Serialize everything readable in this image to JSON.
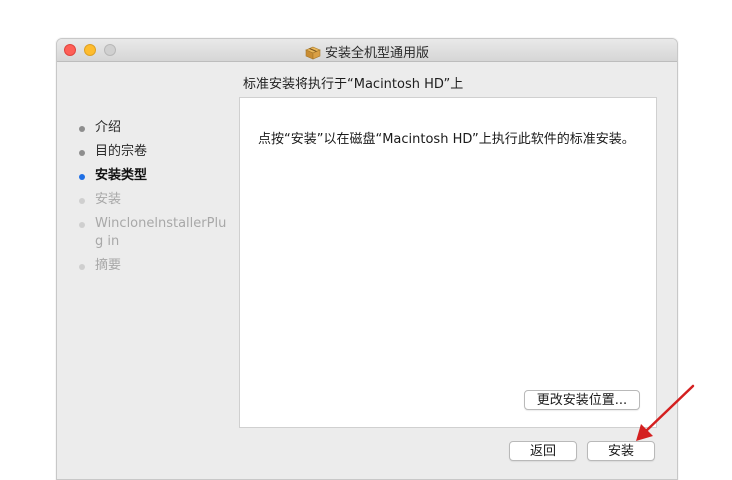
{
  "window": {
    "title": "安装全机型通用版",
    "heading": "标准安装将执行于“Macintosh HD”上"
  },
  "sidebar": {
    "steps": [
      {
        "label": "介绍",
        "state": "done"
      },
      {
        "label": "目的宗卷",
        "state": "done"
      },
      {
        "label": "安装类型",
        "state": "current"
      },
      {
        "label": "安装",
        "state": "todo"
      },
      {
        "label": "WinclonelnstallerPlug in",
        "state": "todo"
      },
      {
        "label": "摘要",
        "state": "todo"
      }
    ]
  },
  "content": {
    "message": "点按“安装”以在磁盘“Macintosh HD”上执行此软件的标准安装。",
    "change_location_label": "更改安装位置..."
  },
  "footer": {
    "back_label": "返回",
    "install_label": "安装"
  },
  "colors": {
    "current_step_dot": "#1f6fe5",
    "annotation_arrow": "#d42020"
  },
  "icons": {
    "window_icon": "package-icon",
    "annotation": "red-arrow-icon"
  }
}
